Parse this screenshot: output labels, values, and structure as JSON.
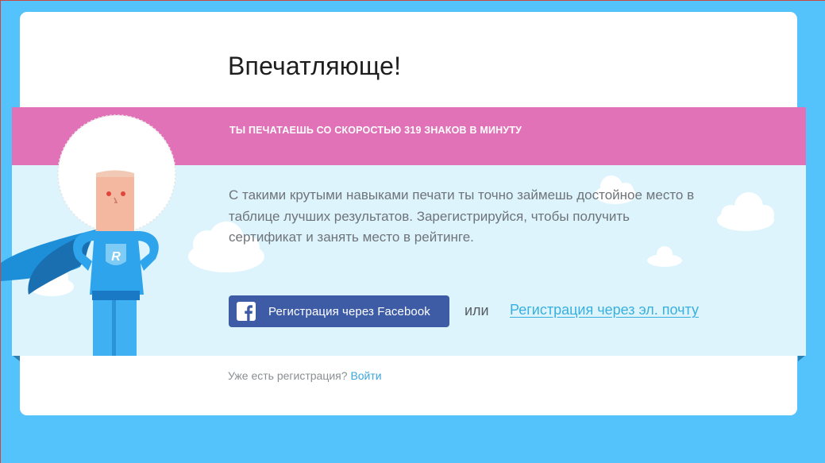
{
  "heading": "Впечатляюще!",
  "result": {
    "speed_text": "ТЫ ПЕЧАТАЕШЬ СО СКОРОСТЬЮ 319 ЗНАКОВ В МИНУТУ"
  },
  "description": "С такими крутыми навыками печати ты точно займешь достойное место в таблице лучших результатов. Зарегистрируйся, чтобы получить сертификат и занять место в рейтинге.",
  "actions": {
    "facebook_label": "Регистрация через Facebook",
    "or_label": "или",
    "email_label": "Регистрация через эл. почту"
  },
  "login": {
    "prompt": "Уже есть регистрация?",
    "link": "Войти"
  },
  "hero": {
    "badge_letter": "R"
  },
  "colors": {
    "background": "#54c2fb",
    "pink_band": "#e272b7",
    "light_blue_band": "#def4fd",
    "facebook": "#3e5ca6",
    "link": "#38b0df"
  },
  "icons": [
    "facebook-icon",
    "cloud-icon",
    "superhero-illustration"
  ]
}
